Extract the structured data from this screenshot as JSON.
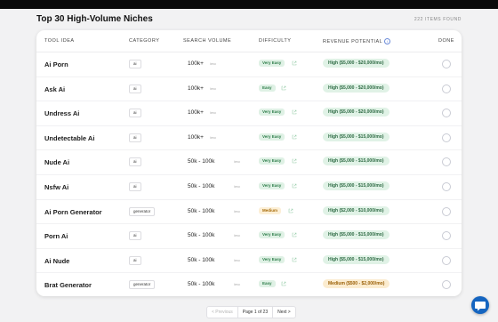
{
  "header": {
    "title": "Top 30 High-Volume Niches",
    "count": "222 ITEMS FOUND"
  },
  "columns": {
    "tool": "TOOL IDEA",
    "category": "CATEGORY",
    "volume": "SEARCH VOLUME",
    "difficulty": "DIFFICULTY",
    "revenue": "REVENUE POTENTIAL",
    "done": "DONE"
  },
  "colors": {
    "very_easy_bg": "#dff1e5",
    "very_easy_fg": "#2e7d4a",
    "easy_bg": "#dff1e5",
    "easy_fg": "#2e7d4a",
    "medium_bg": "#fcefd6",
    "medium_fg": "#a66a07",
    "rev_high_bg": "#e0f2e6",
    "rev_high_fg": "#2e6b44",
    "rev_medium_bg": "#fbecd0",
    "rev_medium_fg": "#9a5f05",
    "chat": "#1565c0"
  },
  "rows": [
    {
      "name": "Ai Porn",
      "category": "ai",
      "volume": "100k+",
      "unit": "/mo",
      "difficulty": "Very Easy",
      "revenue": "High ($5,000 - $20,000/mo)"
    },
    {
      "name": "Ask Ai",
      "category": "ai",
      "volume": "100k+",
      "unit": "/mo",
      "difficulty": "Easy",
      "revenue": "High ($5,000 - $20,000/mo)"
    },
    {
      "name": "Undress Ai",
      "category": "ai",
      "volume": "100k+",
      "unit": "/mo",
      "difficulty": "Very Easy",
      "revenue": "High ($5,000 - $20,000/mo)"
    },
    {
      "name": "Undetectable Ai",
      "category": "ai",
      "volume": "100k+",
      "unit": "/mo",
      "difficulty": "Very Easy",
      "revenue": "High ($5,000 - $15,000/mo)"
    },
    {
      "name": "Nude Ai",
      "category": "ai",
      "volume": "50k - 100k",
      "unit": "/mo",
      "difficulty": "Very Easy",
      "revenue": "High ($5,000 - $15,000/mo)"
    },
    {
      "name": "Nsfw Ai",
      "category": "ai",
      "volume": "50k - 100k",
      "unit": "/mo",
      "difficulty": "Very Easy",
      "revenue": "High ($5,000 - $15,000/mo)"
    },
    {
      "name": "Ai Porn Generator",
      "category": "generator",
      "volume": "50k - 100k",
      "unit": "/mo",
      "difficulty": "Medium",
      "revenue": "High ($2,000 - $10,000/mo)"
    },
    {
      "name": "Porn Ai",
      "category": "ai",
      "volume": "50k - 100k",
      "unit": "/mo",
      "difficulty": "Very Easy",
      "revenue": "High ($5,000 - $15,000/mo)"
    },
    {
      "name": "Ai Nude",
      "category": "ai",
      "volume": "50k - 100k",
      "unit": "/mo",
      "difficulty": "Very Easy",
      "revenue": "High ($5,000 - $15,000/mo)"
    },
    {
      "name": "Brat Generator",
      "category": "generator",
      "volume": "50k - 100k",
      "unit": "/mo",
      "difficulty": "Easy",
      "revenue": "Medium ($500 - $2,000/mo)"
    }
  ],
  "pagination": {
    "prev": "< Previous",
    "info": "Page 1 of 23",
    "next": "Next >"
  }
}
